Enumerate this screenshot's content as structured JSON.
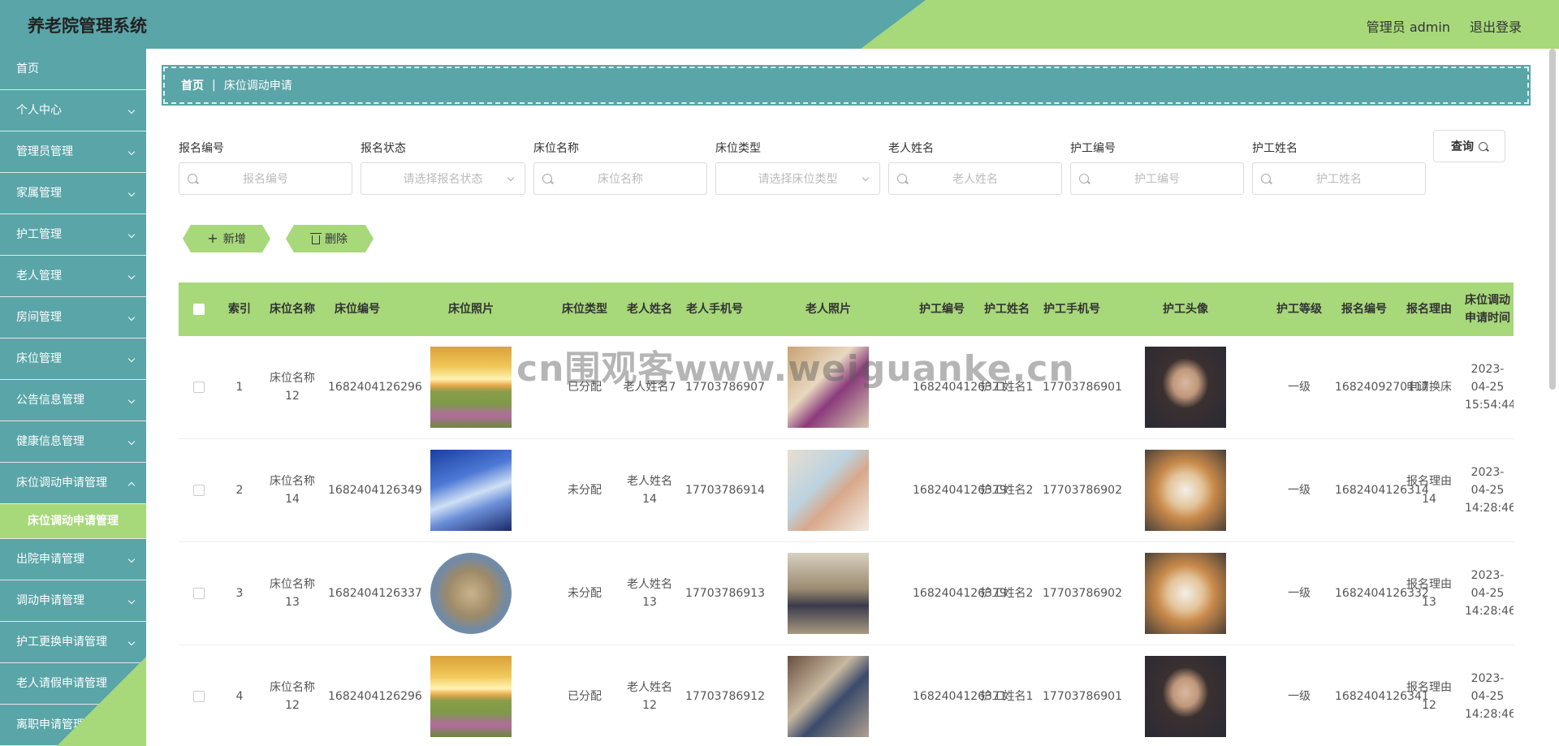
{
  "header": {
    "title": "养老院管理系统",
    "admin_label": "管理员 admin",
    "logout_label": "退出登录"
  },
  "sidebar": {
    "items": [
      {
        "label": "首页",
        "chevron": false
      },
      {
        "label": "个人中心",
        "chevron": true
      },
      {
        "label": "管理员管理",
        "chevron": true
      },
      {
        "label": "家属管理",
        "chevron": true
      },
      {
        "label": "护工管理",
        "chevron": true
      },
      {
        "label": "老人管理",
        "chevron": true
      },
      {
        "label": "房间管理",
        "chevron": true
      },
      {
        "label": "床位管理",
        "chevron": true
      },
      {
        "label": "公告信息管理",
        "chevron": true
      },
      {
        "label": "健康信息管理",
        "chevron": true
      },
      {
        "label": "床位调动申请管理",
        "chevron": true,
        "open": true
      },
      {
        "label": "出院申请管理",
        "chevron": true
      },
      {
        "label": "调动申请管理",
        "chevron": true
      },
      {
        "label": "护工更换申请管理",
        "chevron": true
      },
      {
        "label": "老人请假申请管理",
        "chevron": true
      },
      {
        "label": "离职申请管理",
        "chevron": true
      }
    ],
    "active_sub": "床位调动申请管理"
  },
  "breadcrumb": {
    "home": "首页",
    "separator": "|",
    "current": "床位调动申请"
  },
  "search": {
    "fields": [
      {
        "label": "报名编号",
        "placeholder": "报名编号",
        "type": "input"
      },
      {
        "label": "报名状态",
        "placeholder": "请选择报名状态",
        "type": "select"
      },
      {
        "label": "床位名称",
        "placeholder": "床位名称",
        "type": "input"
      },
      {
        "label": "床位类型",
        "placeholder": "请选择床位类型",
        "type": "select"
      },
      {
        "label": "老人姓名",
        "placeholder": "老人姓名",
        "type": "input"
      },
      {
        "label": "护工编号",
        "placeholder": "护工编号",
        "type": "input"
      },
      {
        "label": "护工姓名",
        "placeholder": "护工姓名",
        "type": "input"
      }
    ],
    "query_label": "查询"
  },
  "actions": {
    "add_label": "新增",
    "delete_label": "删除"
  },
  "table": {
    "headers": [
      "",
      "索引",
      "床位名称",
      "床位编号",
      "床位照片",
      "床位类型",
      "老人姓名",
      "老人手机号",
      "老人照片",
      "护工编号",
      "护工姓名",
      "护工手机号",
      "护工头像",
      "护工等级",
      "报名编号",
      "报名理由",
      "床位调动申请时间"
    ],
    "rows": [
      {
        "index": "1",
        "bed_name": "床位名称12",
        "bed_no": "1682404126296",
        "bed_photo": "sunset-field",
        "bed_type": "已分配",
        "elder_name": "老人姓名7",
        "elder_phone": "17703786907",
        "elder_photo": "elder-care-1",
        "worker_no": "1682404126371",
        "worker_name": "护工姓名1",
        "worker_phone": "17703786901",
        "worker_avatar": "man-portrait",
        "worker_level": "一级",
        "apply_no": "1682409270117",
        "reason": "申请换床",
        "apply_time": "2023-04-25 15:54:44"
      },
      {
        "index": "2",
        "bed_name": "床位名称14",
        "bed_no": "1682404126349",
        "bed_photo": "blue-sky",
        "bed_type": "未分配",
        "elder_name": "老人姓名14",
        "elder_phone": "17703786914",
        "elder_photo": "elder-care-2",
        "worker_no": "1682404126379",
        "worker_name": "护工姓名2",
        "worker_phone": "17703786902",
        "worker_avatar": "shiba-dog",
        "worker_level": "一级",
        "apply_no": "1682404126314",
        "reason": "报名理由14",
        "apply_time": "2023-04-25 14:28:46"
      },
      {
        "index": "3",
        "bed_name": "床位名称13",
        "bed_no": "1682404126337",
        "bed_photo": "desert-circle",
        "bed_type": "未分配",
        "elder_name": "老人姓名13",
        "elder_phone": "17703786913",
        "elder_photo": "elder-care-3",
        "worker_no": "1682404126379",
        "worker_name": "护工姓名2",
        "worker_phone": "17703786902",
        "worker_avatar": "shiba-dog",
        "worker_level": "一级",
        "apply_no": "1682404126332",
        "reason": "报名理由13",
        "apply_time": "2023-04-25 14:28:46"
      },
      {
        "index": "4",
        "bed_name": "床位名称12",
        "bed_no": "1682404126296",
        "bed_photo": "sunset-field",
        "bed_type": "已分配",
        "elder_name": "老人姓名12",
        "elder_phone": "17703786912",
        "elder_photo": "elder-care-4",
        "worker_no": "1682404126371",
        "worker_name": "护工姓名1",
        "worker_phone": "17703786901",
        "worker_avatar": "man-portrait",
        "worker_level": "一级",
        "apply_no": "1682404126341",
        "reason": "报名理由12",
        "apply_time": "2023-04-25 14:28:46"
      }
    ]
  },
  "watermark": "cn围观客www.weiguanke.cn",
  "colors": {
    "teal": "#5aa5a8",
    "green": "#a7d87a"
  }
}
